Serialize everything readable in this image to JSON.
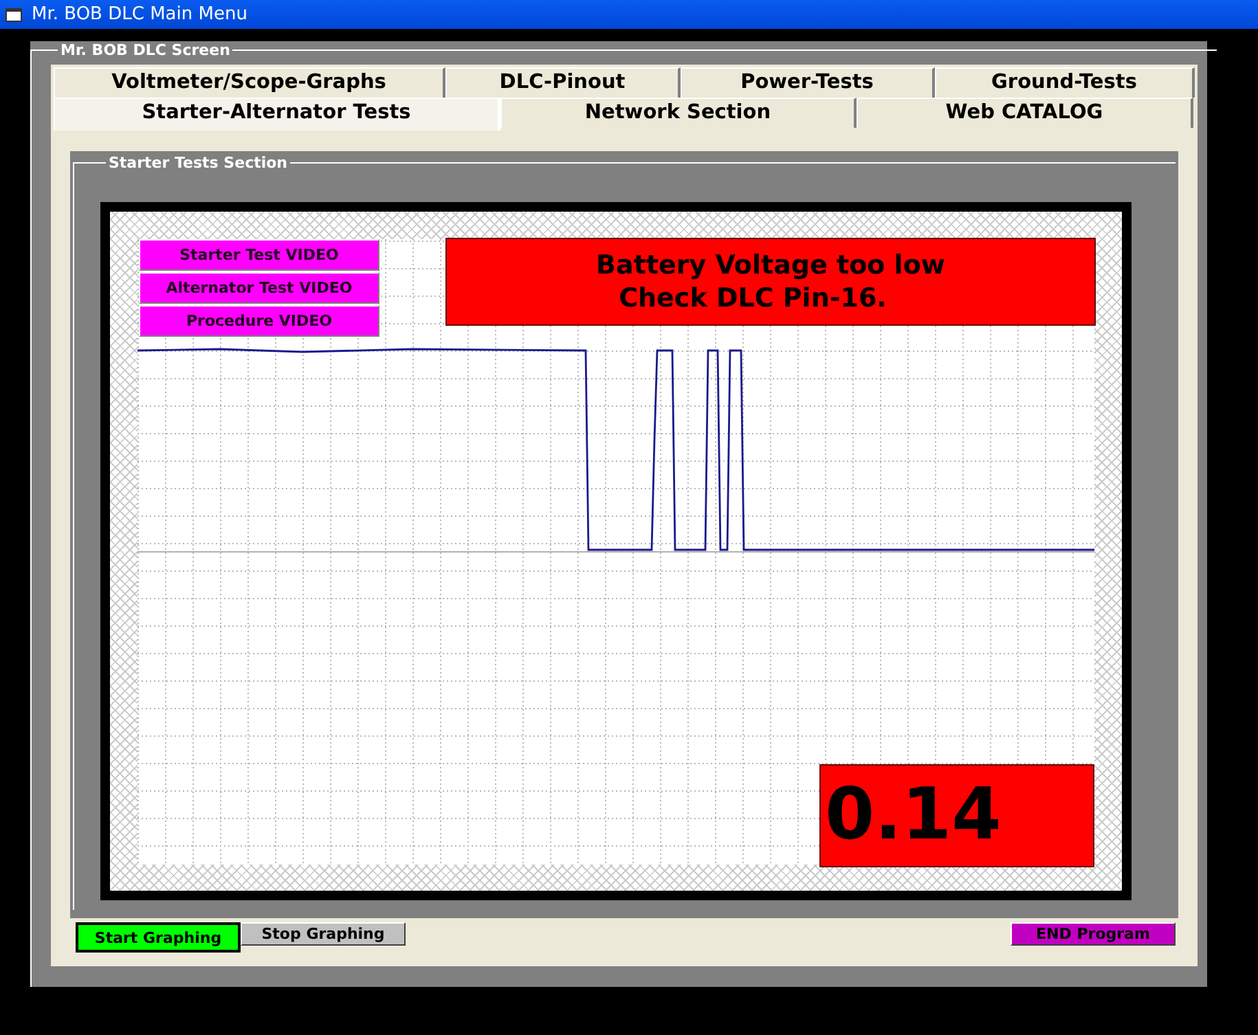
{
  "window": {
    "title": "Mr. BOB DLC Main Menu"
  },
  "frame_title": "Mr. BOB DLC Screen",
  "tab_rows": [
    [
      {
        "label": "Voltmeter/Scope-Graphs",
        "selected": false
      },
      {
        "label": "DLC-Pinout",
        "selected": false
      },
      {
        "label": "Power-Tests",
        "selected": false
      },
      {
        "label": "Ground-Tests",
        "selected": false
      }
    ],
    [
      {
        "label": "Starter-Alternator Tests",
        "selected": true
      },
      {
        "label": "Network Section",
        "selected": false
      },
      {
        "label": "Web CATALOG",
        "selected": false
      }
    ]
  ],
  "section_title": "Starter Tests Section",
  "video_buttons": [
    "Starter Test VIDEO",
    "Alternator Test VIDEO",
    "Procedure VIDEO"
  ],
  "alert": {
    "lines": [
      "Battery Voltage too low",
      "Check DLC Pin-16."
    ]
  },
  "reading": "0.14",
  "bottom_buttons": [
    {
      "label": "Start Graphing",
      "color": "#00ff00",
      "selected": true
    },
    {
      "label": "Stop Graphing",
      "color": "#c0c0c0",
      "selected": false
    },
    {
      "label": "END Program",
      "color": "#c000c0",
      "selected": false
    }
  ]
}
